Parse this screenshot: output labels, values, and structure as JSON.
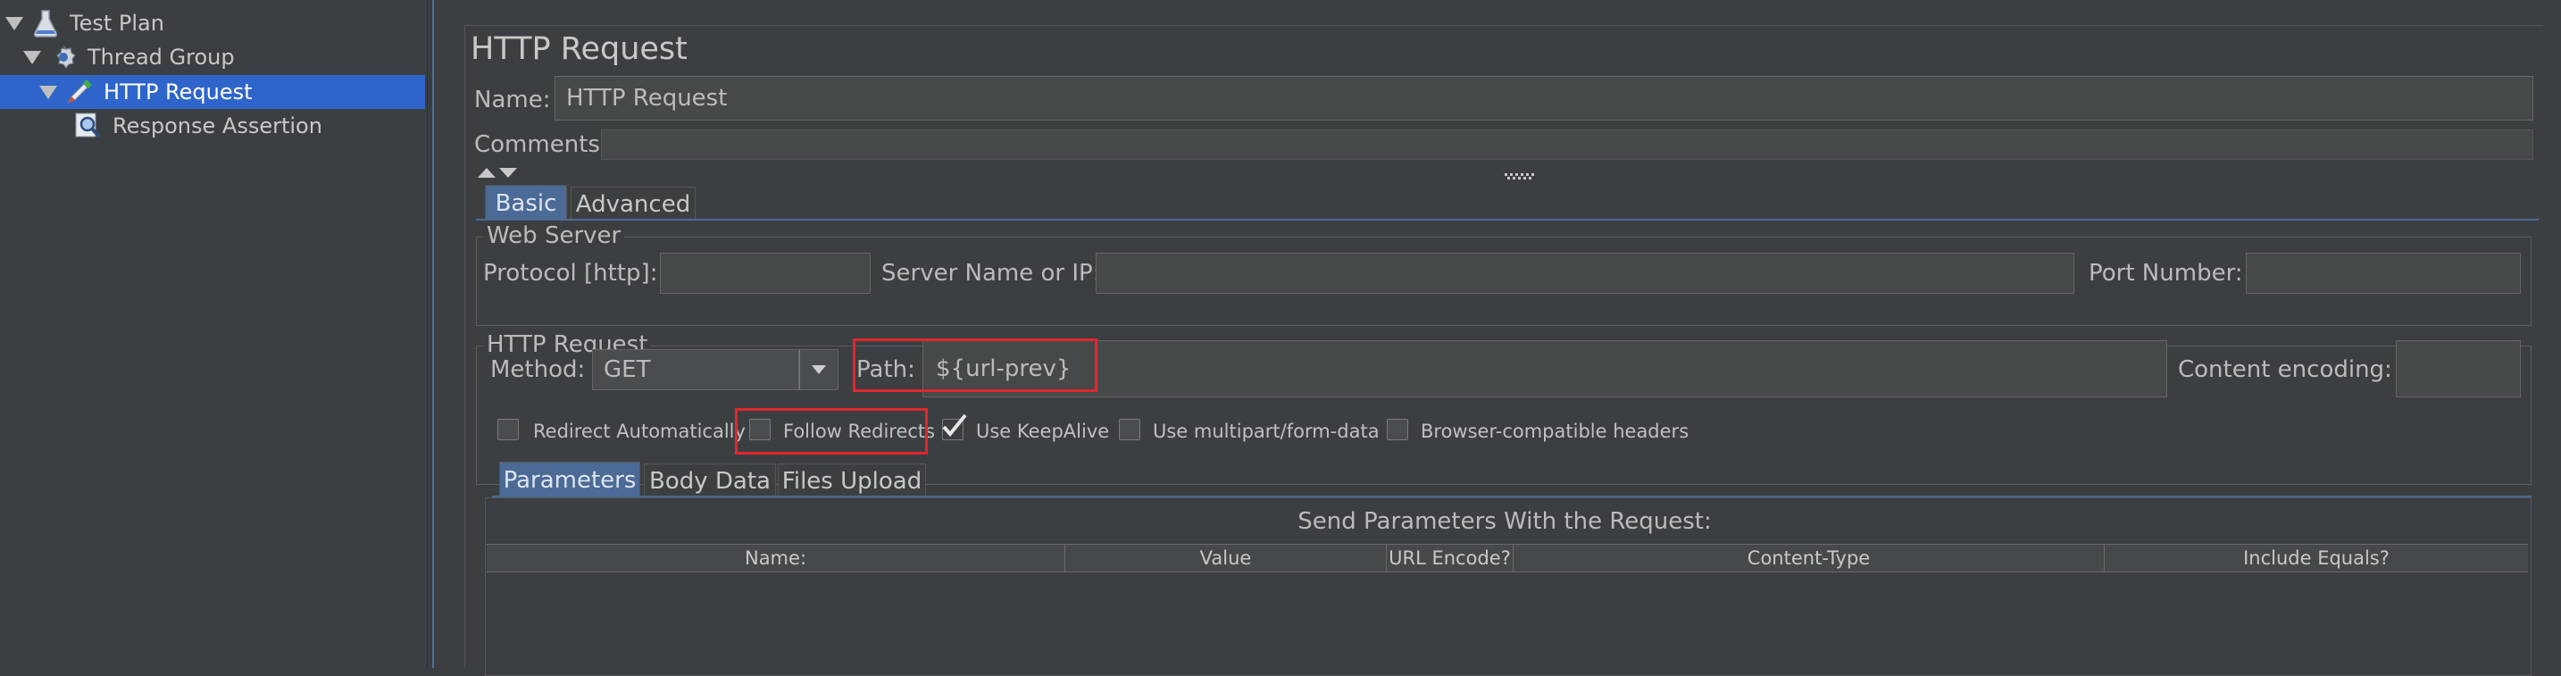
{
  "tree": {
    "items": [
      {
        "label": "Test Plan",
        "icon": "flask-icon"
      },
      {
        "label": "Thread Group",
        "icon": "gear-icon"
      },
      {
        "label": "HTTP Request",
        "icon": "pipette-icon"
      },
      {
        "label": "Response Assertion",
        "icon": "magnifier-icon"
      }
    ]
  },
  "panel": {
    "title": "HTTP Request",
    "name_label": "Name:",
    "name_value": "HTTP Request",
    "comments_label": "Comments:",
    "tabs": [
      {
        "label": "Basic"
      },
      {
        "label": "Advanced"
      }
    ],
    "web_server": {
      "title": "Web Server",
      "protocol_label": "Protocol [http]:",
      "protocol_value": "",
      "server_label": "Server Name or IP:",
      "server_value": "",
      "port_label": "Port Number:",
      "port_value": ""
    },
    "http_request": {
      "title": "HTTP Request",
      "method_label": "Method:",
      "method_value": "GET",
      "path_label": "Path:",
      "path_value": "${url-prev}",
      "encoding_label": "Content encoding:",
      "encoding_value": "",
      "checkboxes": [
        {
          "label": "Redirect Automatically",
          "checked": false
        },
        {
          "label": "Follow Redirects",
          "checked": false
        },
        {
          "label": "Use KeepAlive",
          "checked": true
        },
        {
          "label": "Use multipart/form-data",
          "checked": false
        },
        {
          "label": "Browser-compatible headers",
          "checked": false
        }
      ]
    },
    "param_tabs": [
      {
        "label": "Parameters"
      },
      {
        "label": "Body Data"
      },
      {
        "label": "Files Upload"
      }
    ],
    "params_title": "Send Parameters With the Request:",
    "columns": [
      "Name:",
      "Value",
      "URL Encode?",
      "Content-Type",
      "Include Equals?"
    ]
  },
  "colors": {
    "background": "#3c3f41",
    "selection": "#2f65ca",
    "tab_selected": "#4b6a96",
    "highlight": "#e2262d"
  }
}
